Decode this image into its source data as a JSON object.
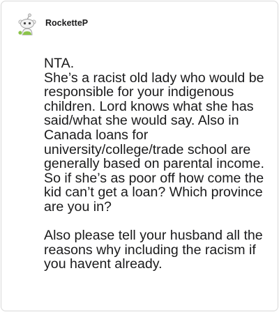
{
  "comment": {
    "username": "RocketteP",
    "avatar_icon": "snoo-avatar-icon",
    "paragraphs": [
      "NTA.\nShe’s a racist old lady who would be responsible for your indigenous children. Lord knows what she has said/what she would say. Also in Canada loans for university/college/trade school are generally based on parental income. So if she’s as poor off how come the kid can’t get a loan? Which province are you in?",
      "Also please tell your husband all the reasons why including the racism if you havent already."
    ]
  },
  "colors": {
    "text": "#1a1a1b",
    "border": "#d9d9d9",
    "avatar_accent": "#8bc34a",
    "avatar_body": "#f2f2f2"
  }
}
